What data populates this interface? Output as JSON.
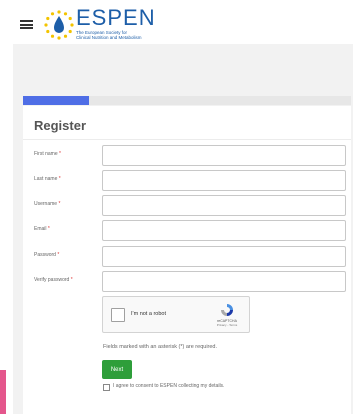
{
  "brand": {
    "name": "ESPEN",
    "subtitle_line1": "The European Society for",
    "subtitle_line2": "Clinical Nutrition and Metabolism"
  },
  "form": {
    "title": "Register",
    "fields": [
      {
        "label": "First name",
        "value": ""
      },
      {
        "label": "Last name",
        "value": ""
      },
      {
        "label": "Username",
        "value": ""
      },
      {
        "label": "Email",
        "value": ""
      },
      {
        "label": "Password",
        "value": ""
      },
      {
        "label": "Verify password",
        "value": ""
      }
    ],
    "required_marker": "*",
    "captcha": {
      "label": "I'm not a robot",
      "brand": "reCAPTCHA",
      "links": "Privacy - Terms"
    },
    "required_note": "Fields marked with an asterisk (*) are required.",
    "next_label": "Next",
    "consent_label": "I agree to consent to ESPEN collecting my details."
  },
  "progress": {
    "fraction": 0.2
  },
  "colors": {
    "accent": "#4f6ee6",
    "next_button": "#2e9e3a",
    "brand_blue": "#1d5ea8",
    "side_tab": "#e4568c"
  }
}
